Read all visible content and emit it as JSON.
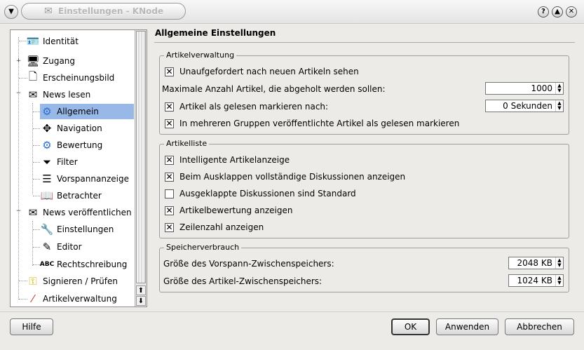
{
  "window": {
    "title": "Einstellungen - KNode",
    "help_button": "?",
    "shade_button": "▲",
    "close_button": "✕"
  },
  "tree": {
    "items": [
      {
        "label": "Identität",
        "icon": "identity-card-icon"
      },
      {
        "label": "Zugang",
        "icon": "server-tower-icon"
      },
      {
        "label": "Erscheinungsbild",
        "icon": "blank-page-icon"
      },
      {
        "label": "News lesen",
        "icon": "envelope-read-icon"
      },
      {
        "label": "Allgemein",
        "icon": "gear-icon"
      },
      {
        "label": "Navigation",
        "icon": "move-arrows-icon"
      },
      {
        "label": "Bewertung",
        "icon": "gear-icon"
      },
      {
        "label": "Filter",
        "icon": "funnel-icon"
      },
      {
        "label": "Vorspannanzeige",
        "icon": "lines-list-icon"
      },
      {
        "label": "Betrachter",
        "icon": "book-icon"
      },
      {
        "label": "News veröffentlichen",
        "icon": "envelope-send-icon"
      },
      {
        "label": "Einstellungen",
        "icon": "wrench-icon"
      },
      {
        "label": "Editor",
        "icon": "pen-editor-icon"
      },
      {
        "label": "Rechtschreibung",
        "icon": "abc-spellcheck-icon"
      },
      {
        "label": "Signieren / Prüfen",
        "icon": "key-icon"
      },
      {
        "label": "Artikelverwaltung",
        "icon": "magic-wand-icon"
      }
    ],
    "selected": "Allgemein"
  },
  "page": {
    "title": "Allgemeine Einstellungen",
    "group1": {
      "legend": "Artikelverwaltung",
      "check_unaufgefordert": "Unaufgefordert nach neuen Artikeln sehen",
      "max_label": "Maximale Anzahl Artikel, die abgeholt werden sollen:",
      "max_value": "1000",
      "mark_read_label": "Artikel als gelesen markieren nach:",
      "mark_read_value": "0 Sekunden",
      "check_crosspost": "In mehreren Gruppen veröffentlichte Artikel als gelesen markieren"
    },
    "group2": {
      "legend": "Artikelliste",
      "check_smart": "Intelligente Artikelanzeige",
      "check_expand": "Beim Ausklappen vollständige Diskussionen anzeigen",
      "check_default": "Ausgeklappte Diskussionen sind Standard",
      "check_score": "Artikelbewertung anzeigen",
      "check_lines": "Zeilenzahl anzeigen"
    },
    "group3": {
      "legend": "Speicherverbrauch",
      "header_cache_label": "Größe des Vorspann-Zwischenspeichers:",
      "header_cache_value": "2048 KB",
      "article_cache_label": "Größe des Artikel-Zwischenspeichers:",
      "article_cache_value": "1024 KB"
    }
  },
  "buttons": {
    "help": "Hilfe",
    "ok": "OK",
    "apply": "Anwenden",
    "cancel": "Abbrechen"
  },
  "checks": {
    "unaufgefordert": true,
    "mark_read": true,
    "crosspost": true,
    "smart": true,
    "expand": true,
    "default": false,
    "score": true,
    "lines": true
  }
}
